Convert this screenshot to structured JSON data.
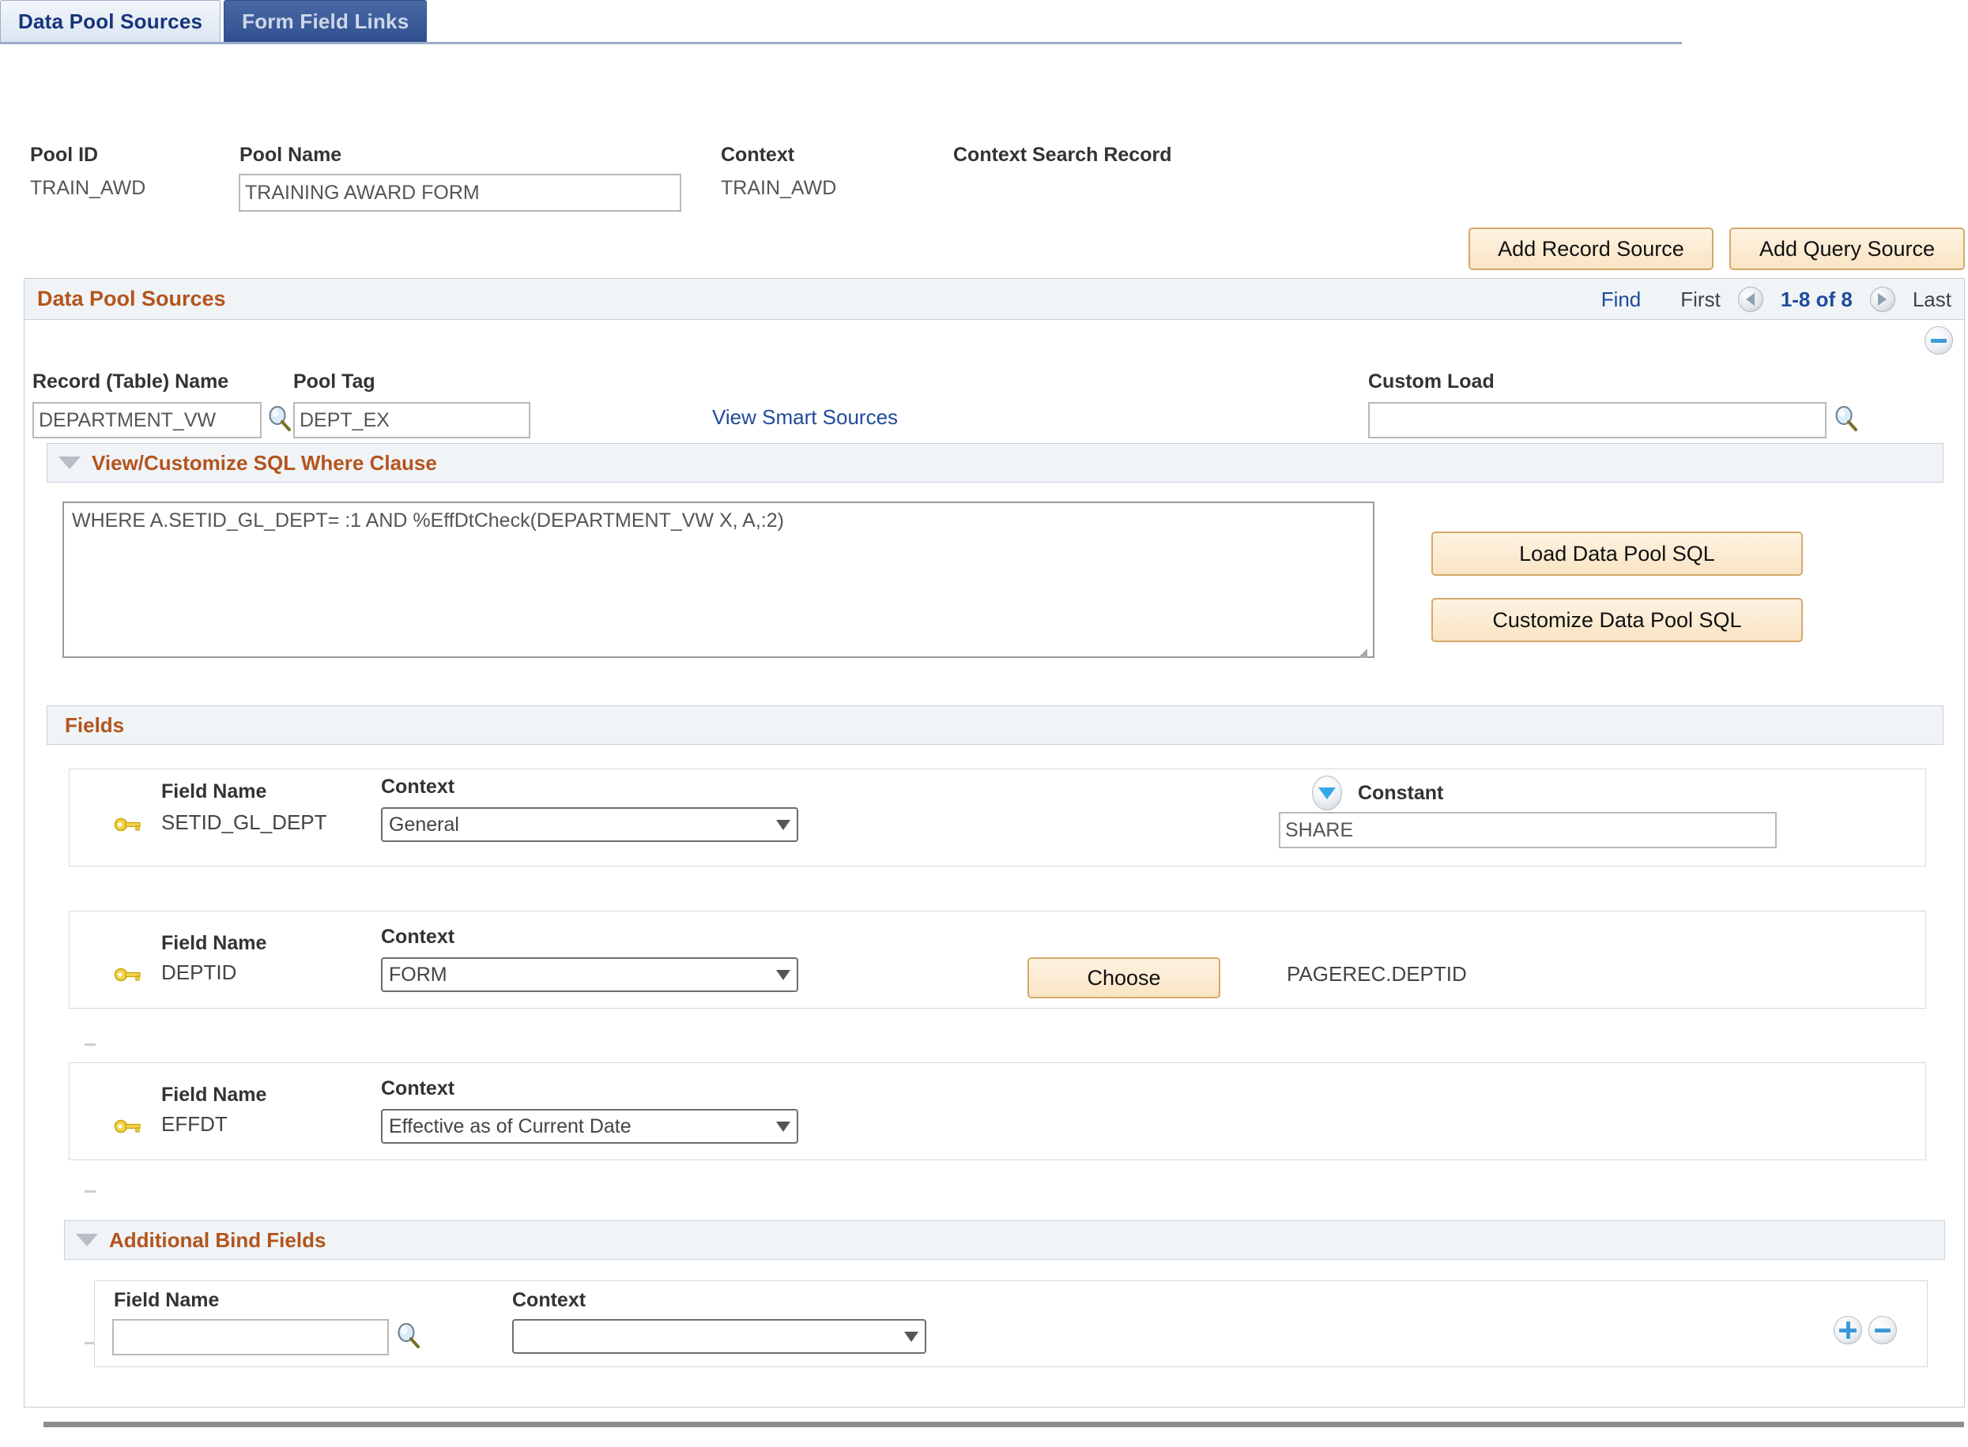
{
  "tabs": [
    {
      "label": "Data Pool Sources",
      "active": true
    },
    {
      "label": "Form Field Links",
      "active": false
    }
  ],
  "header": {
    "pool_id_label": "Pool ID",
    "pool_id_value": "TRAIN_AWD",
    "pool_name_label": "Pool Name",
    "pool_name_value": "TRAINING AWARD FORM",
    "context_label": "Context",
    "context_value": "TRAIN_AWD",
    "context_search_record_label": "Context Search Record",
    "context_search_record_value": ""
  },
  "toolbar": {
    "add_record_source": "Add Record Source",
    "add_query_source": "Add Query Source"
  },
  "data_pool_sources": {
    "title": "Data Pool Sources",
    "nav": {
      "find": "Find",
      "first": "First",
      "count": "1-8 of 8",
      "last": "Last",
      "prev_icon": "prev-arrow-icon",
      "next_icon": "next-arrow-icon"
    },
    "collapse_icon": "collapse-minus-icon",
    "record_name_label": "Record (Table) Name",
    "record_name_value": "DEPARTMENT_VW",
    "record_name_lookup_icon": "magnifier-icon",
    "pool_tag_label": "Pool Tag",
    "pool_tag_value": "DEPT_EX",
    "view_smart_sources": "View Smart Sources",
    "custom_load_label": "Custom Load",
    "custom_load_value": "",
    "custom_load_lookup_icon": "magnifier-icon"
  },
  "sql_section": {
    "title": "View/Customize SQL Where Clause",
    "disclose_icon": "triangle-down-icon",
    "where_clause": "WHERE A.SETID_GL_DEPT= :1 AND %EffDtCheck(DEPARTMENT_VW X, A,:2)",
    "load_button": "Load Data Pool SQL",
    "customize_button": "Customize Data Pool SQL"
  },
  "fields_section": {
    "title": "Fields",
    "field_name_label": "Field Name",
    "context_label": "Context",
    "constant_label": "Constant",
    "constant_toggle_icon": "triangle-down-oval-icon",
    "key_icon": "key-icon",
    "rows": [
      {
        "field_name": "SETID_GL_DEPT",
        "context": "General",
        "constant": "SHARE",
        "has_constant": true,
        "has_choose": false,
        "choose_label": "",
        "bound_value": ""
      },
      {
        "field_name": "DEPTID",
        "context": "FORM",
        "constant": "",
        "has_constant": false,
        "has_choose": true,
        "choose_label": "Choose",
        "bound_value": "PAGEREC.DEPTID"
      },
      {
        "field_name": "EFFDT",
        "context": "Effective as of Current Date",
        "constant": "",
        "has_constant": false,
        "has_choose": false,
        "choose_label": "",
        "bound_value": ""
      }
    ]
  },
  "additional_bind_fields": {
    "title": "Additional Bind Fields",
    "disclose_icon": "triangle-down-icon",
    "field_name_label": "Field Name",
    "field_name_value": "",
    "field_name_lookup_icon": "magnifier-icon",
    "context_label": "Context",
    "context_value": "",
    "add_row_icon": "plus-circle-icon",
    "delete_row_icon": "minus-circle-icon"
  }
}
